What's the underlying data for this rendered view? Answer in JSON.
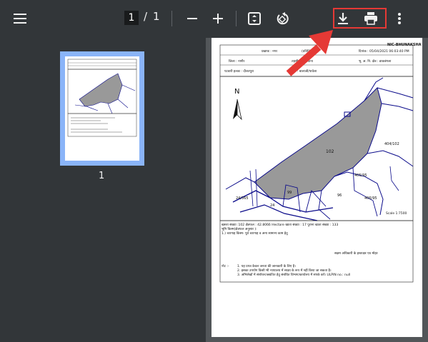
{
  "toolbar": {
    "current_page": "1",
    "separator": "/",
    "total_pages": "1"
  },
  "sidebar": {
    "thumbnail_label": "1"
  },
  "document": {
    "header_right": "NIC-BHUNAKSHA",
    "header_line1_left": "प्रखण्ड : नगर",
    "header_line1_mid": "(प्रतिलिपि)",
    "header_line1_right": "दिनांक : 05/04/2021 06:03:40 PM",
    "header_line2_left": "जिला : नागौर",
    "header_line2_mid": "तहसील : डीडवाना",
    "header_line2_right": "भू. अ. नि. क्षेत्र : डाकबंगला",
    "header_line3_left": "पटवारी हल्का : दौलतपुरा",
    "header_line3_mid": "ग्राम : बालाजी/पावेला",
    "north": "N",
    "parcel_main": "102",
    "parcels": [
      "404/102",
      "405/95",
      "406/95",
      "96",
      "99",
      "24/365",
      "24"
    ],
    "scale": "Scale 1:7500",
    "info_line1": "खसरा संख्या :102 क्षेत्रफल : 42.8066 Hectare  खाता संख्या : 17 पुराना खाता संख्या : 133",
    "info_line2": "भूमि किस्म(क्षेत्रफल अनुसार ):",
    "info_line3": "1.) चरागाह  किस्म- पूर्व   चरागाह व अन्य सामान्य काम हेतु",
    "signature": "सक्षम अधिकारी के हस्ताक्षर एव मोहर",
    "note_label": "नोट :-",
    "note1": "1. यह प्रपत्र केवल जनता की जानकारी के लिए है।",
    "note2": "2. इसका उपयोग किसी भी न्यायालय में साक्ष्य के रूप में नहीं किया जा सकता है।",
    "note3": "3. अभिलेखों में संशोधन/अद्यतित हेतु संबंधित विभाग/कार्यालय में संपर्क करें।  ULPIN no.: null"
  },
  "colors": {
    "toolbar": "#323639",
    "viewer_bg": "#525659",
    "thumb_highlight": "#8ab4f8",
    "annotation_red": "#e53935",
    "parcel_fill": "#999999",
    "map_line": "#0a0a8a"
  },
  "icons": [
    "menu-icon",
    "zoom-out-icon",
    "zoom-in-icon",
    "fit-page-icon",
    "rotate-icon",
    "download-icon",
    "print-icon",
    "more-vert-icon",
    "north-arrow-icon"
  ]
}
